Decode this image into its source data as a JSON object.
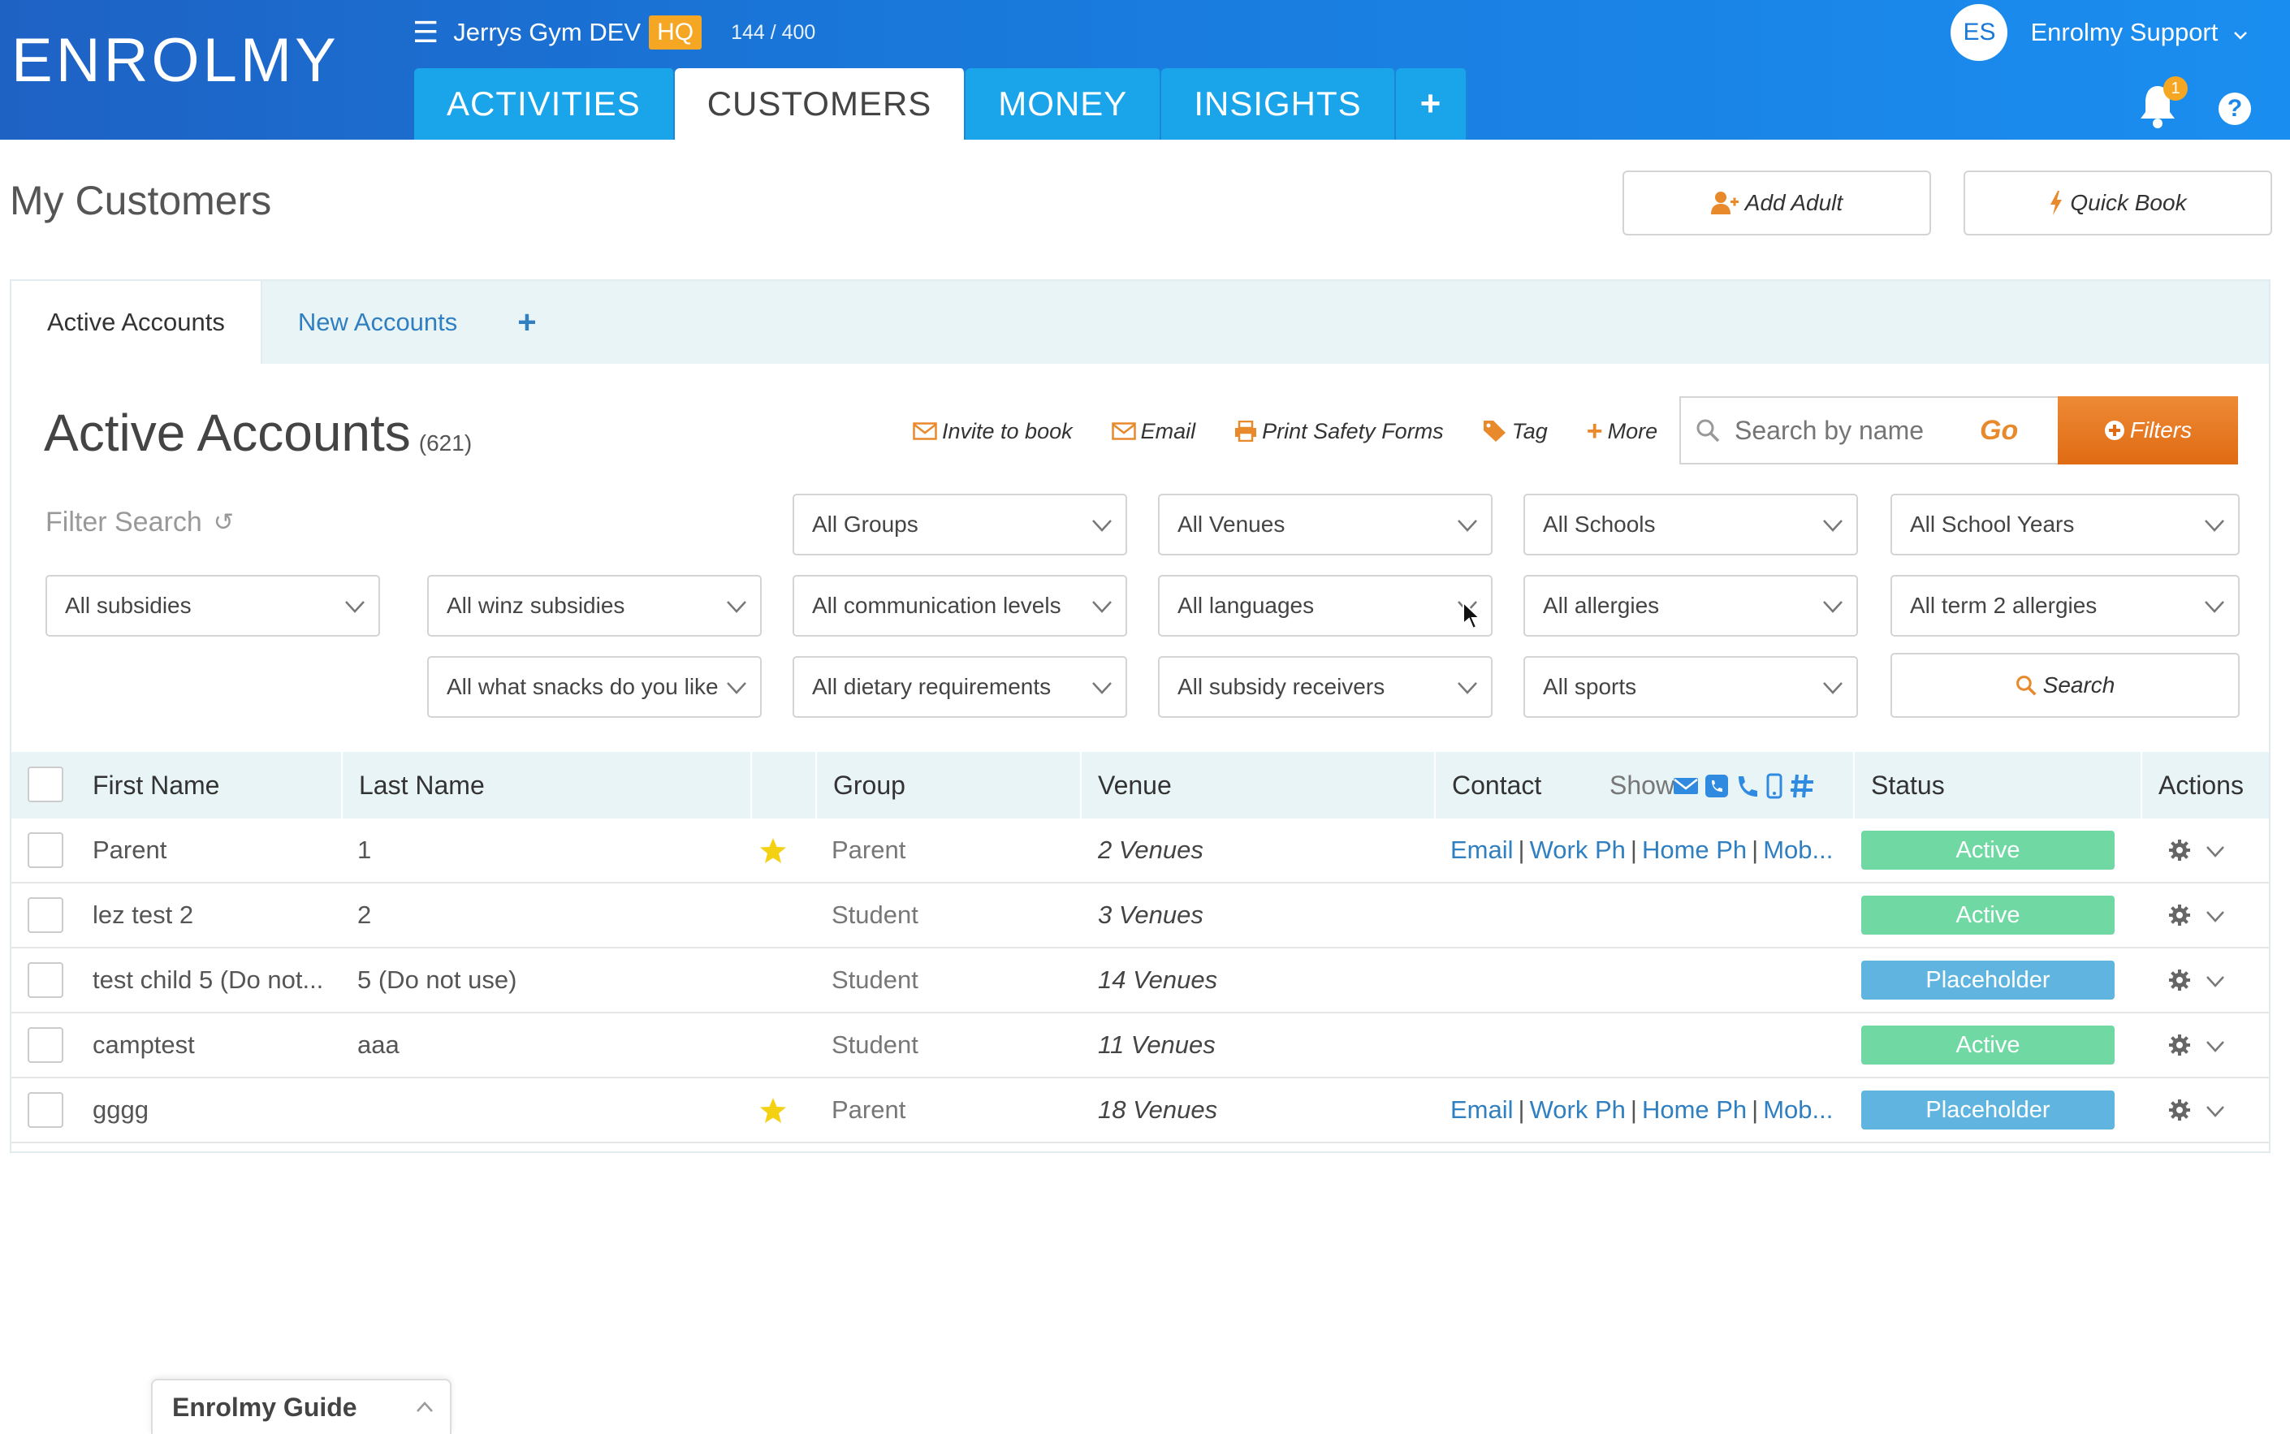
{
  "app": {
    "logo_text": "ENROLMY",
    "org_name": "Jerrys Gym DEV",
    "org_badge": "HQ",
    "capacity": "144 / 400",
    "nav_tabs": [
      "ACTIVITIES",
      "CUSTOMERS",
      "MONEY",
      "INSIGHTS"
    ],
    "active_tab": "CUSTOMERS",
    "user_initials": "ES",
    "user_name": "Enrolmy Support",
    "notification_count": "1",
    "help_label": "?"
  },
  "page": {
    "title": "My Customers",
    "add_adult_label": "Add Adult",
    "quick_book_label": "Quick Book"
  },
  "subtabs": [
    "Active Accounts",
    "New Accounts"
  ],
  "accounts": {
    "title": "Active Accounts",
    "count": "(621)",
    "actions": {
      "invite": "Invite to book",
      "email": "Email",
      "print": "Print Safety Forms",
      "tag": "Tag",
      "more": "More"
    },
    "search_placeholder": "Search by name",
    "go_label": "Go",
    "filters_label": "Filters",
    "filter_search_label": "Filter Search",
    "search_button_label": "Search"
  },
  "filters": {
    "groups": "All Groups",
    "venues": "All Venues",
    "schools": "All Schools",
    "school_years": "All School Years",
    "subsidies": "All subsidies",
    "winz": "All winz subsidies",
    "communication": "All communication levels",
    "languages": "All languages",
    "allergies": "All allergies",
    "term2_allergies": "All term 2 allergies",
    "snacks": "All what snacks do you like?",
    "dietary": "All dietary requirements",
    "subsidy_receivers": "All subsidy receivers",
    "sports": "All sports"
  },
  "table": {
    "headers": {
      "first_name": "First Name",
      "last_name": "Last Name",
      "group": "Group",
      "venue": "Venue",
      "contact": "Contact",
      "show": "Show",
      "status": "Status",
      "actions": "Actions"
    },
    "contact_links": [
      "Email",
      "Work Ph",
      "Home Ph",
      "Mob..."
    ],
    "rows": [
      {
        "first": "Parent",
        "last": "1",
        "starred": true,
        "group": "Parent",
        "venue": "2 Venues",
        "has_contact": true,
        "status": "Active"
      },
      {
        "first": "lez test 2",
        "last": "2",
        "starred": false,
        "group": "Student",
        "venue": "3 Venues",
        "has_contact": false,
        "status": "Active"
      },
      {
        "first": "test child 5 (Do not...",
        "last": "5 (Do not use)",
        "starred": false,
        "group": "Student",
        "venue": "14 Venues",
        "has_contact": false,
        "status": "Placeholder"
      },
      {
        "first": "camptest",
        "last": "aaa",
        "starred": false,
        "group": "Student",
        "venue": "11 Venues",
        "has_contact": false,
        "status": "Active"
      },
      {
        "first": "gggg",
        "last": "",
        "starred": true,
        "group": "Parent",
        "venue": "18 Venues",
        "has_contact": true,
        "status": "Placeholder"
      }
    ]
  },
  "guide": {
    "label": "Enrolmy Guide"
  },
  "colors": {
    "brand_blue": "#1a78d6",
    "accent_orange": "#e8892b",
    "status_active": "#6fd8a3",
    "status_placeholder": "#5fb5e0",
    "link_blue": "#2f7fc1"
  }
}
